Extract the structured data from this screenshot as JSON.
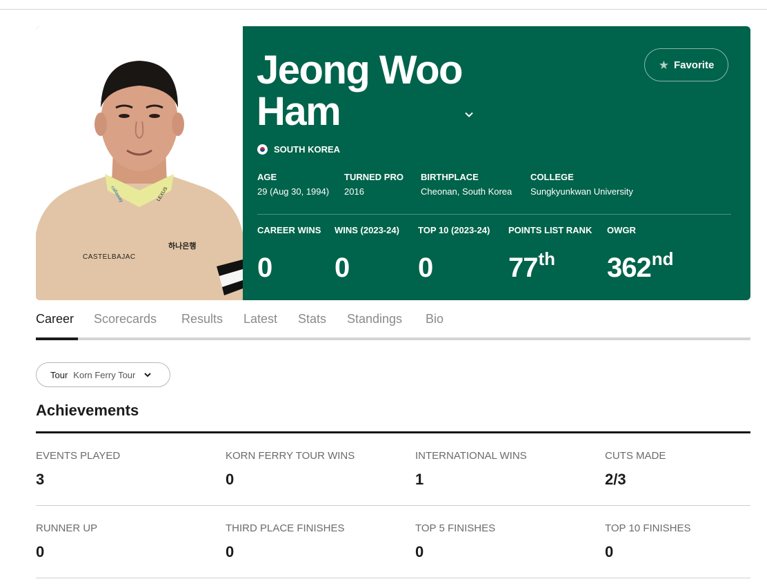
{
  "player": {
    "first_name": "Jeong Woo",
    "last_name": "Ham",
    "country": "SOUTH KOREA",
    "favorite_label": "Favorite",
    "photo_texts": {
      "sponsor_left": "CASTELBAJAC",
      "sponsor_right": "하나은행",
      "collar_left": "callaway",
      "collar_right": "LEXUS"
    }
  },
  "bio": [
    {
      "label": "AGE",
      "value": "29 (Aug 30, 1994)"
    },
    {
      "label": "TURNED PRO",
      "value": "2016"
    },
    {
      "label": "BIRTHPLACE",
      "value": "Cheonan, South Korea"
    },
    {
      "label": "COLLEGE",
      "value": "Sungkyunkwan University"
    }
  ],
  "stats": [
    {
      "label": "CAREER WINS",
      "value": "0",
      "suffix": ""
    },
    {
      "label": "WINS (2023-24)",
      "value": "0",
      "suffix": ""
    },
    {
      "label": "TOP 10 (2023-24)",
      "value": "0",
      "suffix": ""
    },
    {
      "label": "POINTS LIST RANK",
      "value": "77",
      "suffix": "th"
    },
    {
      "label": "OWGR",
      "value": "362",
      "suffix": "nd"
    }
  ],
  "tabs": [
    "Career",
    "Scorecards",
    "Results",
    "Latest",
    "Stats",
    "Standings",
    "Bio"
  ],
  "active_tab": "Career",
  "tour_select": {
    "label": "Tour",
    "value": "Korn Ferry Tour"
  },
  "achievements": {
    "title": "Achievements",
    "items": [
      {
        "label": "EVENTS PLAYED",
        "value": "3"
      },
      {
        "label": "KORN FERRY TOUR WINS",
        "value": "0"
      },
      {
        "label": "INTERNATIONAL WINS",
        "value": "1"
      },
      {
        "label": "CUTS MADE",
        "value": "2/3"
      },
      {
        "label": "RUNNER UP",
        "value": "0"
      },
      {
        "label": "THIRD PLACE FINISHES",
        "value": "0"
      },
      {
        "label": "TOP 5 FINISHES",
        "value": "0"
      },
      {
        "label": "TOP 10 FINISHES",
        "value": "0"
      }
    ]
  },
  "colors": {
    "hero_bg": "#00634b",
    "text_dark": "#1b1b1b",
    "text_muted": "#8a8a8a"
  }
}
